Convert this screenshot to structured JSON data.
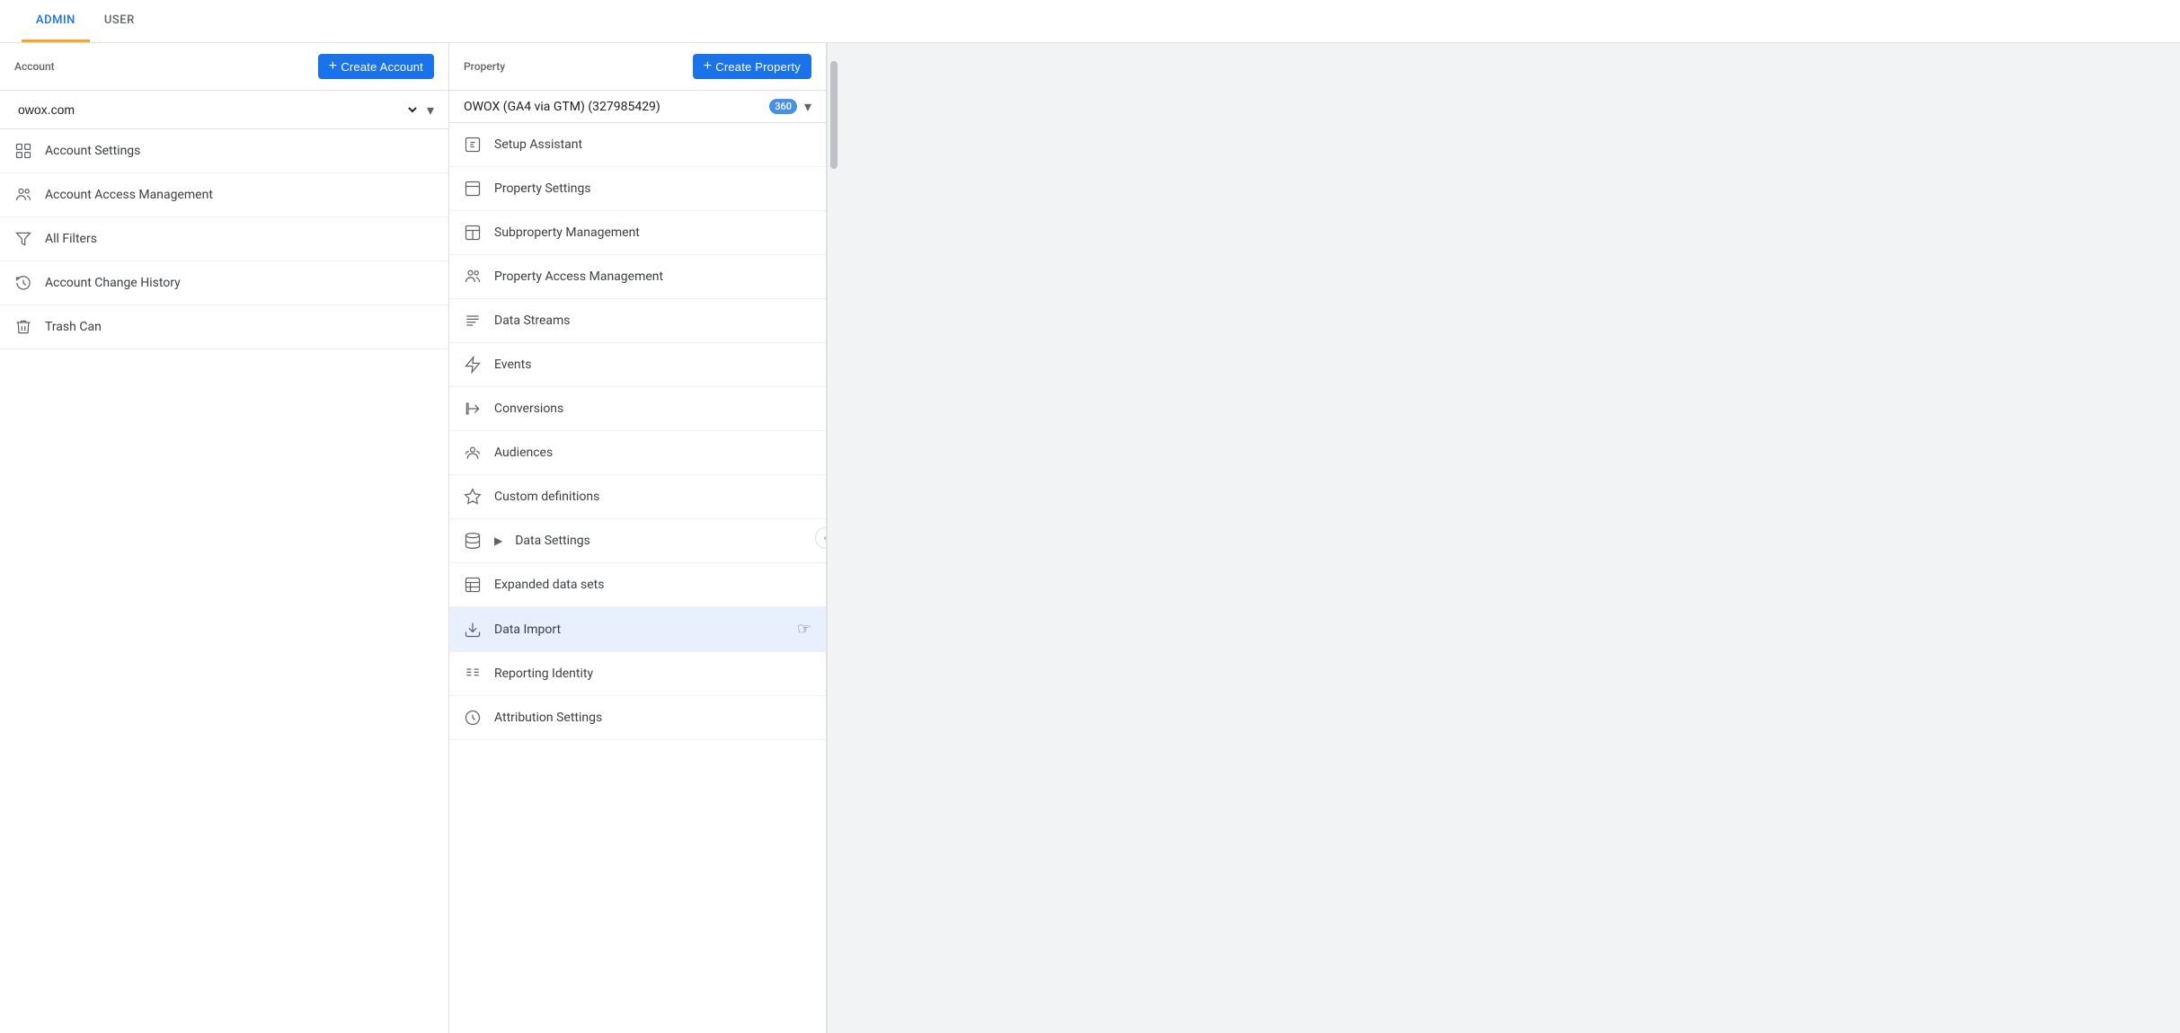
{
  "topNav": {
    "items": [
      {
        "id": "admin",
        "label": "ADMIN",
        "active": true
      },
      {
        "id": "user",
        "label": "USER",
        "active": false
      }
    ]
  },
  "accountColumn": {
    "headerLabel": "Account",
    "createBtn": "+ Create Account",
    "dropdown": {
      "value": "owox.com",
      "placeholder": "owox.com"
    },
    "menuItems": [
      {
        "id": "account-settings",
        "label": "Account Settings",
        "icon": "account-settings-icon"
      },
      {
        "id": "account-access-management",
        "label": "Account Access Management",
        "icon": "people-icon"
      },
      {
        "id": "all-filters",
        "label": "All Filters",
        "icon": "filter-icon"
      },
      {
        "id": "account-change-history",
        "label": "Account Change History",
        "icon": "history-icon"
      },
      {
        "id": "trash-can",
        "label": "Trash Can",
        "icon": "trash-icon"
      }
    ]
  },
  "propertyColumn": {
    "headerLabel": "Property",
    "createBtn": "+ Create Property",
    "dropdown": {
      "value": "OWOX (GA4 via GTM) (327985429)",
      "badge": "360"
    },
    "menuItems": [
      {
        "id": "setup-assistant",
        "label": "Setup Assistant",
        "icon": "setup-icon"
      },
      {
        "id": "property-settings",
        "label": "Property Settings",
        "icon": "property-settings-icon"
      },
      {
        "id": "subproperty-management",
        "label": "Subproperty Management",
        "icon": "subproperty-icon"
      },
      {
        "id": "property-access-management",
        "label": "Property Access Management",
        "icon": "people-icon"
      },
      {
        "id": "data-streams",
        "label": "Data Streams",
        "icon": "data-streams-icon"
      },
      {
        "id": "events",
        "label": "Events",
        "icon": "events-icon"
      },
      {
        "id": "conversions",
        "label": "Conversions",
        "icon": "conversions-icon"
      },
      {
        "id": "audiences",
        "label": "Audiences",
        "icon": "audiences-icon"
      },
      {
        "id": "custom-definitions",
        "label": "Custom definitions",
        "icon": "custom-def-icon"
      },
      {
        "id": "data-settings",
        "label": "Data Settings",
        "icon": "data-settings-icon",
        "expandable": true
      },
      {
        "id": "expanded-data-sets",
        "label": "Expanded data sets",
        "icon": "expanded-data-icon"
      },
      {
        "id": "data-import",
        "label": "Data Import",
        "icon": "data-import-icon",
        "active": true
      },
      {
        "id": "reporting-identity",
        "label": "Reporting Identity",
        "icon": "reporting-icon"
      },
      {
        "id": "attribution-settings",
        "label": "Attribution Settings",
        "icon": "attribution-icon"
      }
    ]
  }
}
